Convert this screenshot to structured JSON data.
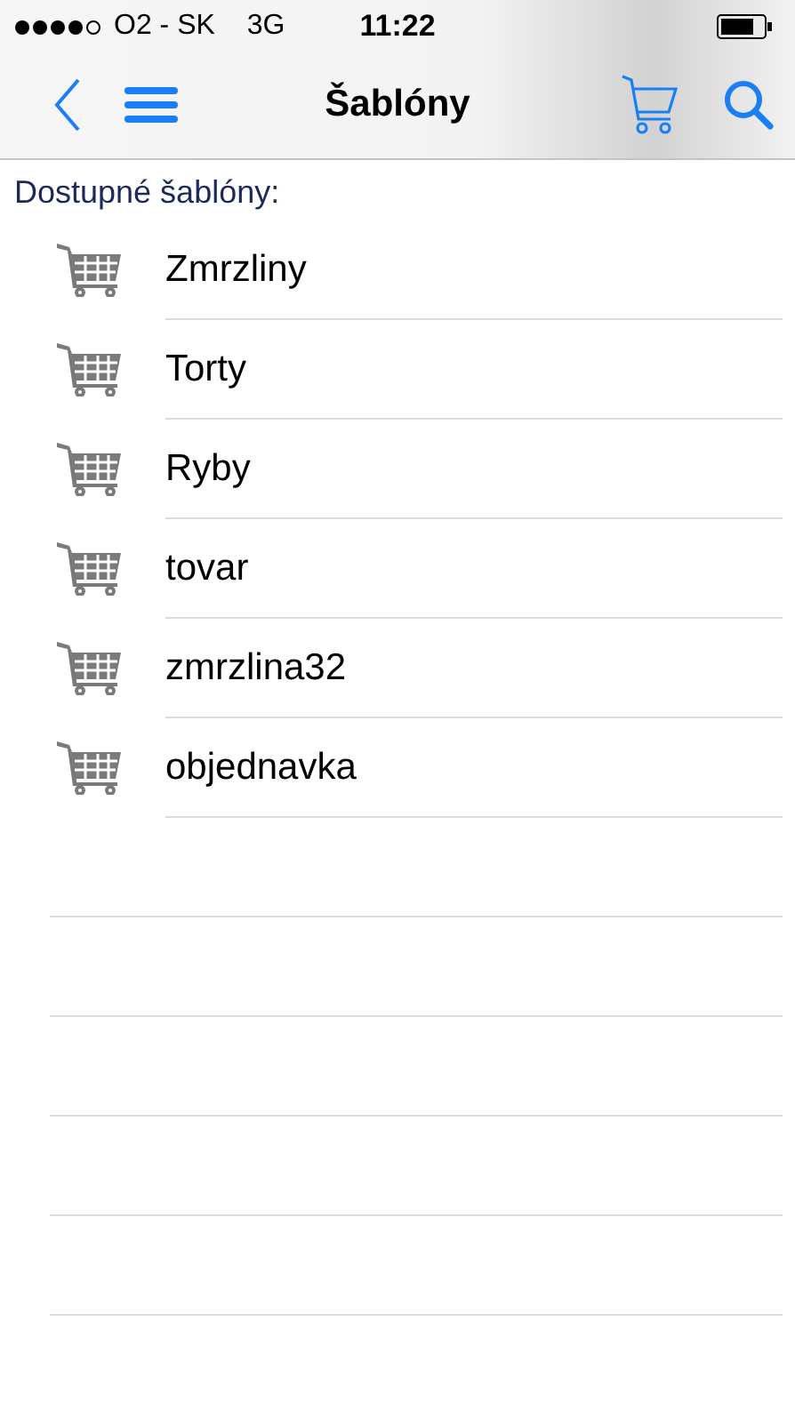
{
  "status_bar": {
    "carrier": "O2 - SK",
    "network": "3G",
    "time": "11:22"
  },
  "nav_bar": {
    "title": "Šablóny"
  },
  "section_title": "Dostupné šablóny:",
  "templates": [
    {
      "name": "Zmrzliny"
    },
    {
      "name": "Torty"
    },
    {
      "name": "Ryby"
    },
    {
      "name": "tovar"
    },
    {
      "name": "zmrzlina32"
    },
    {
      "name": "objednavka"
    }
  ]
}
